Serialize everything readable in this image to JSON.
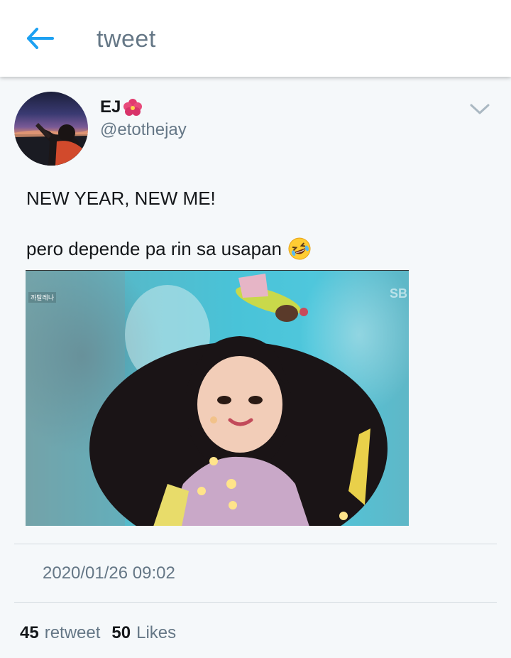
{
  "header": {
    "title": "tweet",
    "back_icon": "arrow-left-icon",
    "accent": "#1da1f2"
  },
  "tweet": {
    "author": {
      "display_name": "EJ",
      "name_emoji": "hibiscus-icon",
      "handle": "@etothejay"
    },
    "menu_icon": "chevron-down-icon",
    "text_line1": "NEW YEAR, NEW ME!",
    "text_line2": "pero depende pa rin sa usapan",
    "text_emoji": "rolling-on-floor-laughing-icon",
    "media": {
      "caption_overlay": "까탈레나",
      "logo": "SB"
    },
    "timestamp": "2020/01/26 09:02",
    "stats": {
      "retweets": "45",
      "retweet_label": "retweet",
      "likes": "50",
      "likes_label": "Likes"
    }
  },
  "colors": {
    "background": "#f5f8fa",
    "secondary_text": "#657786",
    "primary_text": "#14171a"
  }
}
